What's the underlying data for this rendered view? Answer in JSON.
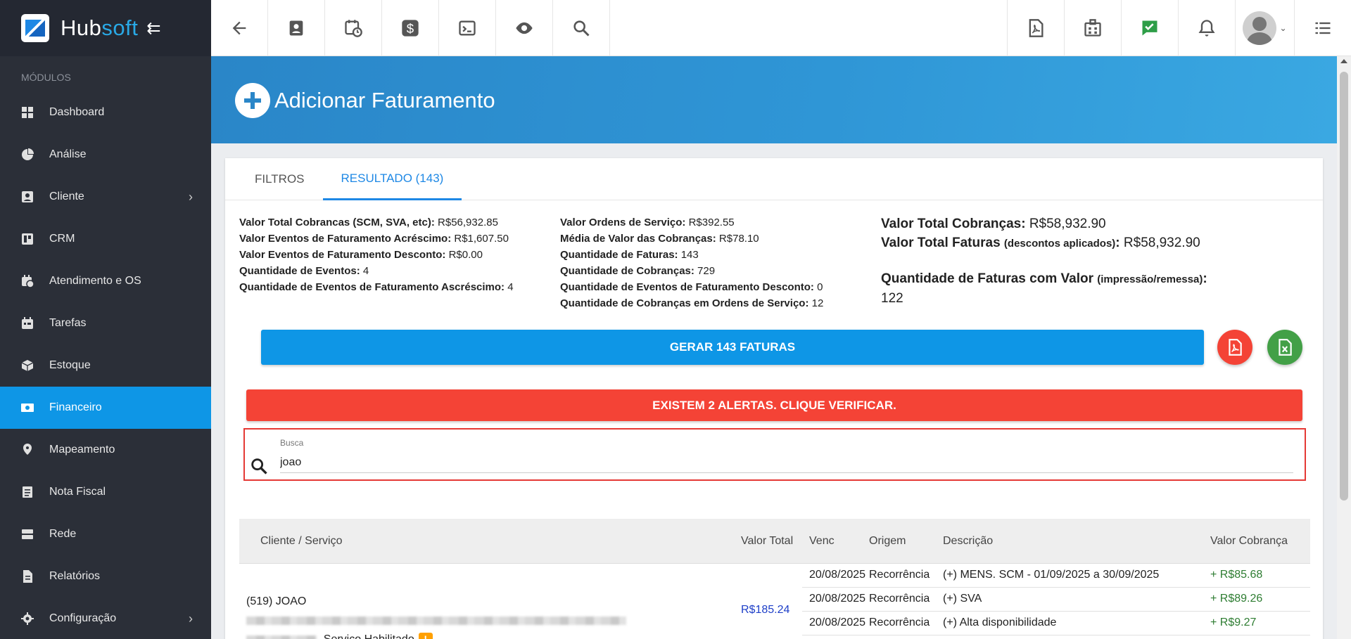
{
  "brand": {
    "name_a": "Hub",
    "name_b": "soft"
  },
  "sidebar": {
    "section_label": "MÓDULOS",
    "items": [
      {
        "label": "Dashboard",
        "icon": "dashboard-icon"
      },
      {
        "label": "Análise",
        "icon": "pie-chart-icon"
      },
      {
        "label": "Cliente",
        "icon": "contact-icon",
        "has_submenu": true
      },
      {
        "label": "CRM",
        "icon": "crm-icon"
      },
      {
        "label": "Atendimento e OS",
        "icon": "calendar-clock-icon"
      },
      {
        "label": "Tarefas",
        "icon": "tasks-icon"
      },
      {
        "label": "Estoque",
        "icon": "box-icon"
      },
      {
        "label": "Financeiro",
        "icon": "money-icon",
        "active": true
      },
      {
        "label": "Mapeamento",
        "icon": "map-pin-icon"
      },
      {
        "label": "Nota Fiscal",
        "icon": "invoice-icon"
      },
      {
        "label": "Rede",
        "icon": "network-icon"
      },
      {
        "label": "Relatórios",
        "icon": "report-icon"
      },
      {
        "label": "Configuração",
        "icon": "gear-icon",
        "has_submenu": true
      }
    ]
  },
  "header": {
    "title": "Adicionar Faturamento"
  },
  "tabs": [
    {
      "label": "FILTROS"
    },
    {
      "label": "RESULTADO (143)",
      "active": true
    }
  ],
  "stats_col1": [
    {
      "label": "Valor Total Cobrancas (SCM, SVA, etc):",
      "value": "R$56,932.85"
    },
    {
      "label": "Valor Eventos de Faturamento Acréscimo:",
      "value": "R$1,607.50"
    },
    {
      "label": "Valor Eventos de Faturamento Desconto:",
      "value": "R$0.00"
    },
    {
      "label": "Quantidade de Eventos:",
      "value": "4"
    },
    {
      "label": "Quantidade de Eventos de Faturamento Ascréscimo:",
      "value": "4"
    }
  ],
  "stats_col2": [
    {
      "label": "Valor Ordens de Serviço:",
      "value": "R$392.55"
    },
    {
      "label": "Média de Valor das Cobranças:",
      "value": "R$78.10"
    },
    {
      "label": "Quantidade de Faturas:",
      "value": "143"
    },
    {
      "label": "Quantidade de Cobranças:",
      "value": "729"
    },
    {
      "label": "Quantidade de Eventos de Faturamento Desconto:",
      "value": "0"
    },
    {
      "label": "Quantidade de Cobranças em Ordens de Serviço:",
      "value": "12"
    }
  ],
  "stats_col3": {
    "total_cobrancas_label": "Valor Total Cobranças:",
    "total_cobrancas_value": "R$58,932.90",
    "total_faturas_label": "Valor Total Faturas",
    "total_faturas_note": "(descontos aplicados)",
    "total_faturas_value": "R$58,932.90",
    "qtd_faturas_label": "Quantidade de Faturas com Valor",
    "qtd_faturas_note": "(impressão/remessa)",
    "qtd_faturas_value": "122"
  },
  "actions": {
    "generate_label": "GERAR 143 FATURAS",
    "alert_label": "EXISTEM 2 ALERTAS. CLIQUE VERIFICAR."
  },
  "search": {
    "label": "Busca",
    "value": "joao"
  },
  "table": {
    "headers": {
      "client": "Cliente / Serviço",
      "total": "Valor Total",
      "due": "Venc",
      "origin": "Origem",
      "description": "Descrição",
      "charge": "Valor Cobrança"
    },
    "rows": [
      {
        "client_prefix": "(519) JOAO",
        "service_status": "- Serviço Habilitado",
        "total": "R$185.24",
        "charges": [
          {
            "due": "20/08/2025",
            "origin": "Recorrência",
            "description": "(+) MENS. SCM - 01/09/2025 a 30/09/2025",
            "amount": "+ R$85.68"
          },
          {
            "due": "20/08/2025",
            "origin": "Recorrência",
            "description": "(+) SVA",
            "amount": "+ R$89.26"
          },
          {
            "due": "20/08/2025",
            "origin": "Recorrência",
            "description": "(+) Alta disponibilidade",
            "amount": "+ R$9.27"
          }
        ]
      }
    ]
  }
}
